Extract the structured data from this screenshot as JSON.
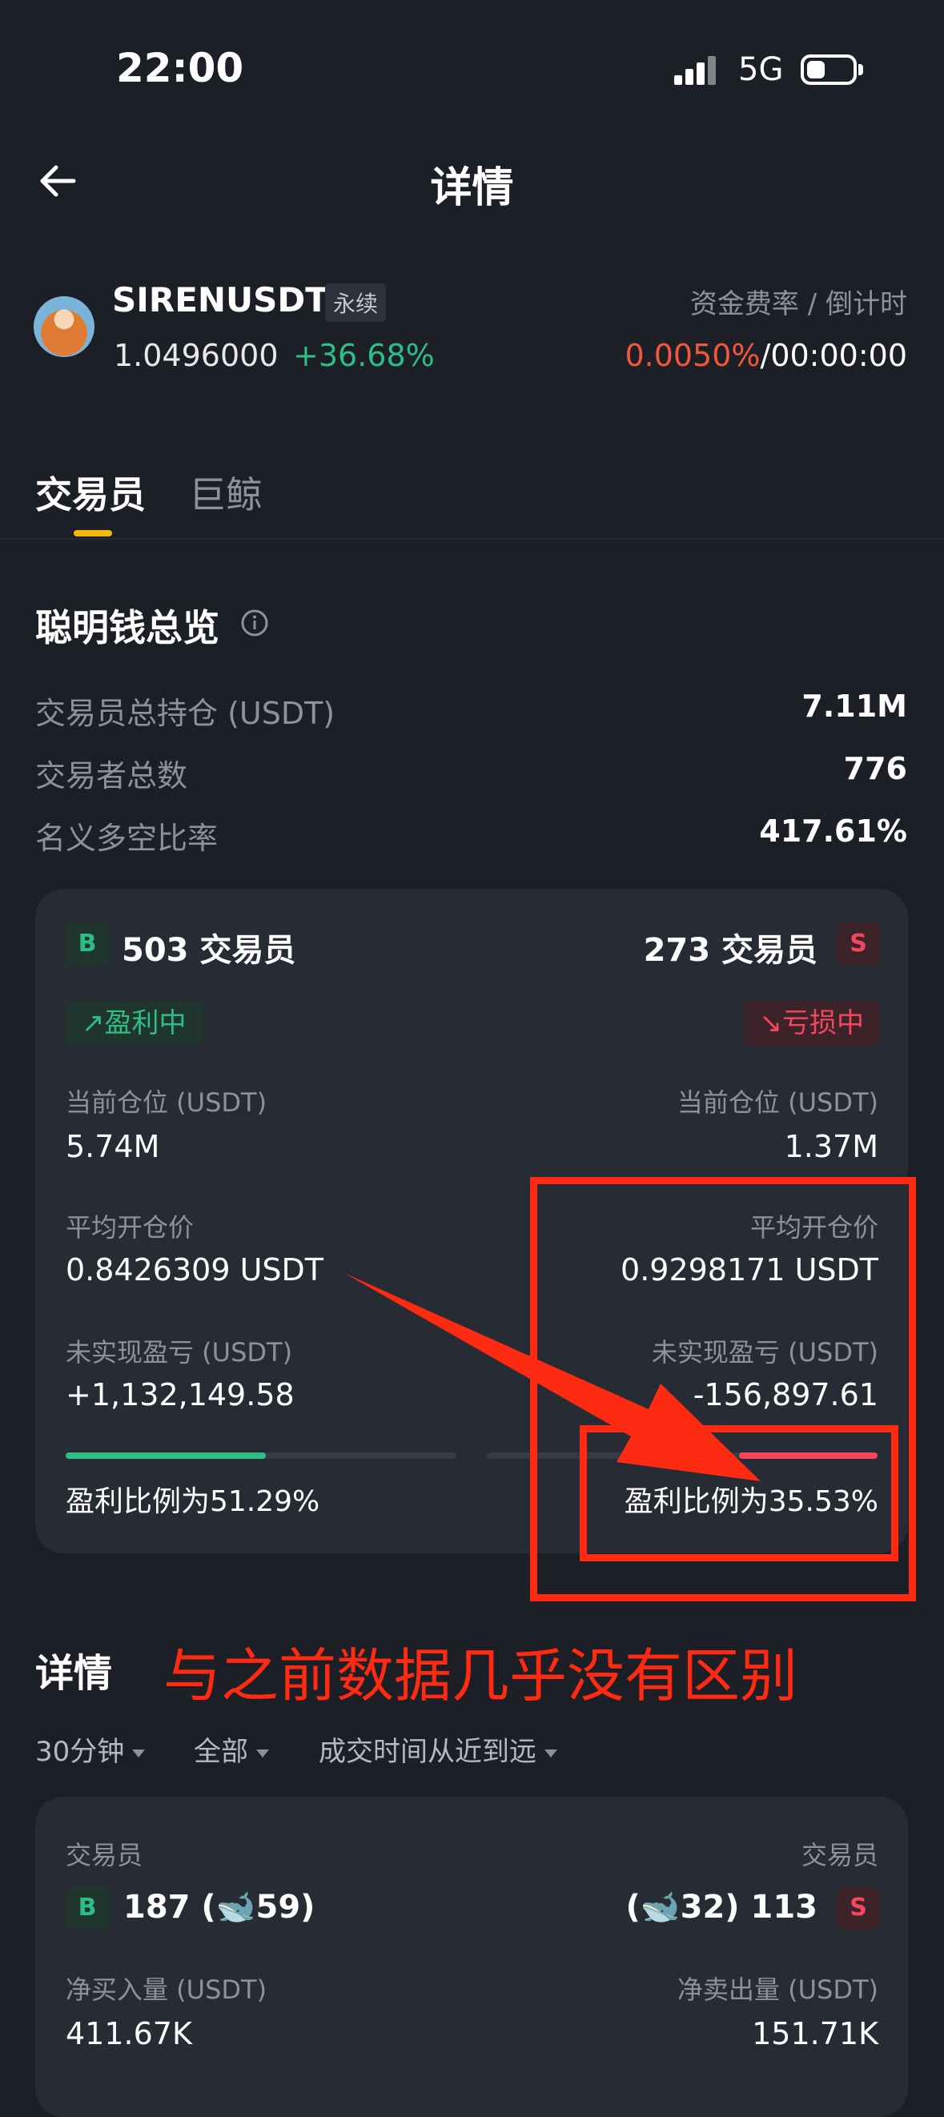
{
  "status": {
    "time": "22:00",
    "network": "5G"
  },
  "header": {
    "title": "详情"
  },
  "symbol": {
    "name": "SIRENUSDT",
    "badge": "永续",
    "price": "1.0496000",
    "change": "+36.68%",
    "funding_label": "资金费率 / 倒计时",
    "funding_rate": "0.0050%",
    "funding_sep": "/",
    "countdown": "00:00:00"
  },
  "tabs": [
    {
      "label": "交易员"
    },
    {
      "label": "巨鲸"
    }
  ],
  "overview": {
    "title": "聪明钱总览",
    "rows": [
      {
        "label": "交易员总持仓 (USDT)",
        "value": "7.11M"
      },
      {
        "label": "交易者总数",
        "value": "776"
      },
      {
        "label": "名义多空比率",
        "value": "417.61%"
      }
    ]
  },
  "card": {
    "long": {
      "badge": "B",
      "traders": "503 交易员",
      "status": "↗盈利中",
      "position_label": "当前仓位 (USDT)",
      "position": "5.74M",
      "avg_label": "平均开仓价",
      "avg_price": "0.8426309 USDT",
      "pnl_label": "未实现盈亏 (USDT)",
      "pnl": "+1,132,149.58",
      "ratio_text": "盈利比例为51.29%",
      "ratio": 0.5129
    },
    "short": {
      "badge": "S",
      "traders": "273 交易员",
      "status": "↘亏损中",
      "position_label": "当前仓位 (USDT)",
      "position": "1.37M",
      "avg_label": "平均开仓价",
      "avg_price": "0.9298171 USDT",
      "pnl_label": "未实现盈亏 (USDT)",
      "pnl": "-156,897.61",
      "ratio_text": "盈利比例为35.53%",
      "ratio": 0.3553
    }
  },
  "annotation": {
    "text": "与之前数据几乎没有区别"
  },
  "details": {
    "title": "详情",
    "filters": [
      "30分钟",
      "全部",
      "成交时间从近到远"
    ],
    "left": {
      "badge": "B",
      "label": "交易员",
      "count": "187 (🐋59)",
      "net_label": "净买入量 (USDT)",
      "net": "411.67K"
    },
    "right": {
      "badge": "S",
      "label": "交易员",
      "count": "(🐋32) 113",
      "net_label": "净卖出量 (USDT)",
      "net": "151.71K"
    }
  },
  "colors": {
    "green": "#2ebd85",
    "red": "#f6465d",
    "accent": "#f0b90b",
    "annotation": "#ff2a12"
  }
}
